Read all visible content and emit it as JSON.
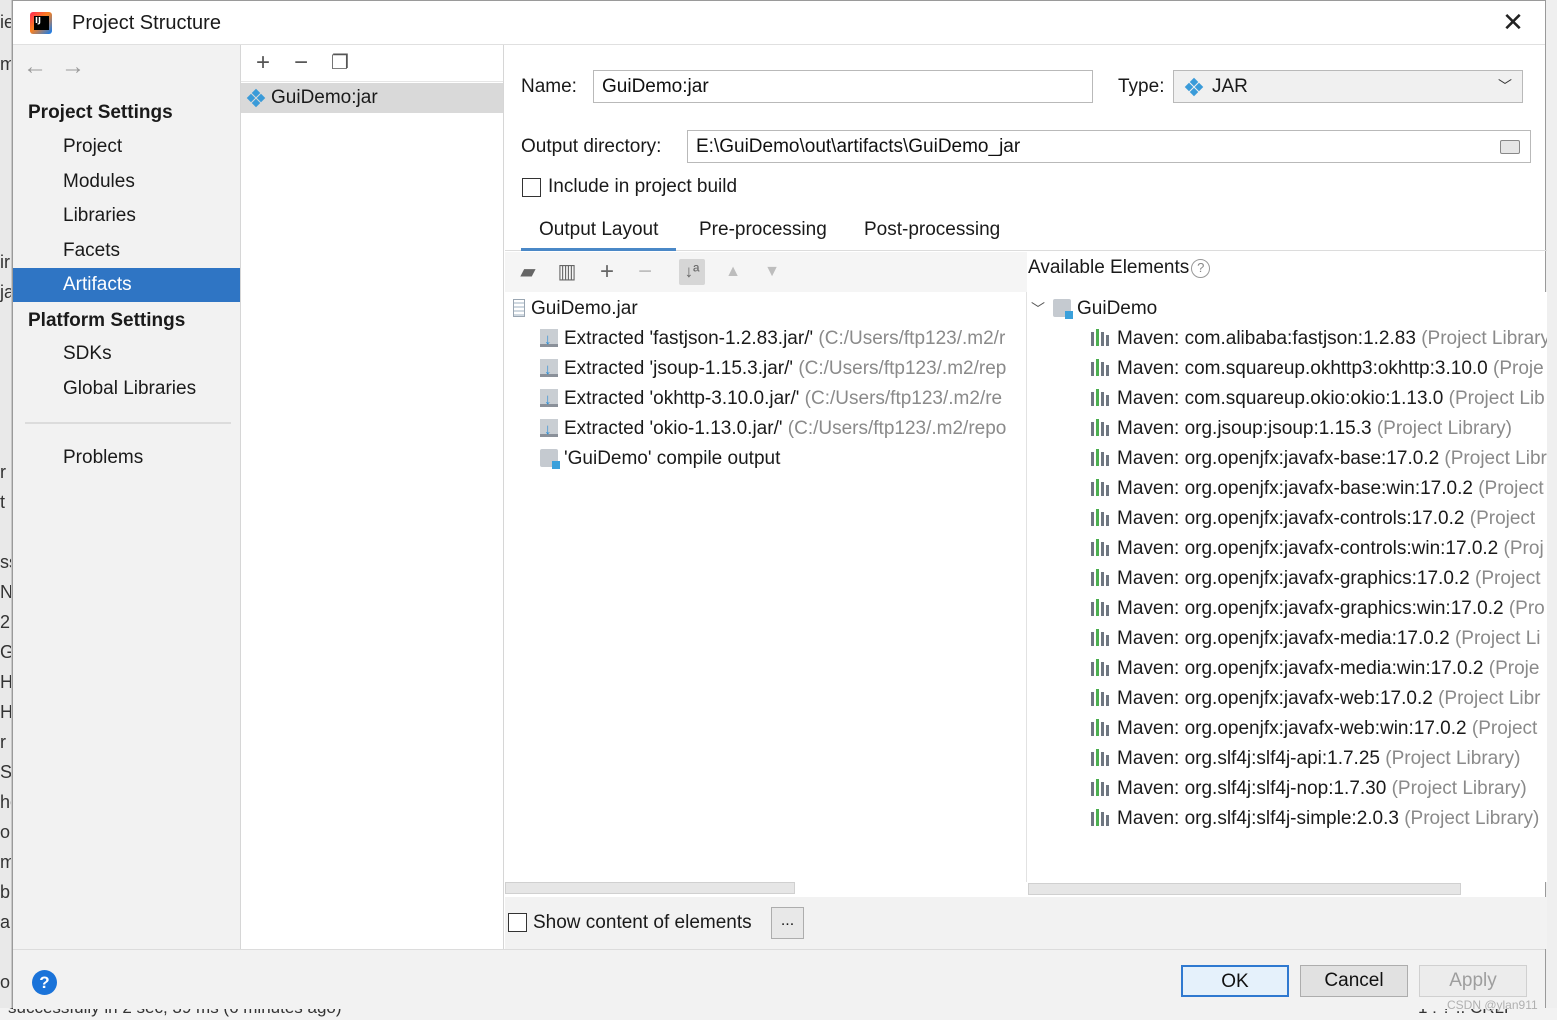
{
  "window": {
    "title": "Project Structure"
  },
  "nav": {
    "project_settings_label": "Project Settings",
    "platform_settings_label": "Platform Settings",
    "items": [
      {
        "label": "Project"
      },
      {
        "label": "Modules"
      },
      {
        "label": "Libraries"
      },
      {
        "label": "Facets"
      },
      {
        "label": "Artifacts",
        "selected": true
      }
    ],
    "platform_items": [
      {
        "label": "SDKs"
      },
      {
        "label": "Global Libraries"
      }
    ],
    "problems_label": "Problems"
  },
  "artifact_list": {
    "items": [
      {
        "label": "GuiDemo:jar",
        "selected": true
      }
    ]
  },
  "form": {
    "name_label": "Name:",
    "name_value": "GuiDemo:jar",
    "type_label": "Type:",
    "type_value": "JAR",
    "output_dir_label": "Output directory:",
    "output_dir_value": "E:\\GuiDemo\\out\\artifacts\\GuiDemo_jar",
    "include_build_label": "Include in project build",
    "include_build_checked": false
  },
  "tabs": [
    {
      "label": "Output Layout",
      "active": true
    },
    {
      "label": "Pre-processing"
    },
    {
      "label": "Post-processing"
    }
  ],
  "output_layout": {
    "root": "GuiDemo.jar",
    "entries": [
      {
        "label": "Extracted 'fastjson-1.2.83.jar/'",
        "path": "(C:/Users/ftp123/.m2/r"
      },
      {
        "label": "Extracted 'jsoup-1.15.3.jar/'",
        "path": "(C:/Users/ftp123/.m2/rep"
      },
      {
        "label": "Extracted 'okhttp-3.10.0.jar/'",
        "path": "(C:/Users/ftp123/.m2/re"
      },
      {
        "label": "Extracted 'okio-1.13.0.jar/'",
        "path": "(C:/Users/ftp123/.m2/repo"
      },
      {
        "label": "'GuiDemo' compile output",
        "path": ""
      }
    ]
  },
  "available": {
    "header": "Available Elements",
    "root": "GuiDemo",
    "libraries": [
      {
        "label": "Maven: com.alibaba:fastjson:1.2.83",
        "suffix": "(Project Library"
      },
      {
        "label": "Maven: com.squareup.okhttp3:okhttp:3.10.0",
        "suffix": "(Proje"
      },
      {
        "label": "Maven: com.squareup.okio:okio:1.13.0",
        "suffix": "(Project Lib"
      },
      {
        "label": "Maven: org.jsoup:jsoup:1.15.3",
        "suffix": "(Project Library)"
      },
      {
        "label": "Maven: org.openjfx:javafx-base:17.0.2",
        "suffix": "(Project Libr"
      },
      {
        "label": "Maven: org.openjfx:javafx-base:win:17.0.2",
        "suffix": "(Project"
      },
      {
        "label": "Maven: org.openjfx:javafx-controls:17.0.2",
        "suffix": "(Project"
      },
      {
        "label": "Maven: org.openjfx:javafx-controls:win:17.0.2",
        "suffix": "(Proj"
      },
      {
        "label": "Maven: org.openjfx:javafx-graphics:17.0.2",
        "suffix": "(Project"
      },
      {
        "label": "Maven: org.openjfx:javafx-graphics:win:17.0.2",
        "suffix": "(Pro"
      },
      {
        "label": "Maven: org.openjfx:javafx-media:17.0.2",
        "suffix": "(Project Li"
      },
      {
        "label": "Maven: org.openjfx:javafx-media:win:17.0.2",
        "suffix": "(Proje"
      },
      {
        "label": "Maven: org.openjfx:javafx-web:17.0.2",
        "suffix": "(Project Libr"
      },
      {
        "label": "Maven: org.openjfx:javafx-web:win:17.0.2",
        "suffix": "(Project"
      },
      {
        "label": "Maven: org.slf4j:slf4j-api:1.7.25",
        "suffix": "(Project Library)"
      },
      {
        "label": "Maven: org.slf4j:slf4j-nop:1.7.30",
        "suffix": "(Project Library)"
      },
      {
        "label": "Maven: org.slf4j:slf4j-simple:2.0.3",
        "suffix": "(Project Library)"
      }
    ]
  },
  "bottom": {
    "show_content_label": "Show content of elements",
    "ellipsis_label": "..."
  },
  "footer": {
    "help_label": "?",
    "ok_label": "OK",
    "cancel_label": "Cancel",
    "apply_label": "Apply"
  },
  "ide_background": {
    "status_text": "successfully in 2 sec, 39 ms (6 minutes ago)",
    "status_right": "1 : ? .. CRLF",
    "left_fragments": [
      "ie",
      "m",
      "ir",
      "ja",
      "r",
      "t",
      "ss",
      "N",
      "2",
      "G",
      "H",
      "H",
      "r",
      "S",
      "he",
      "o",
      "m",
      "b",
      "a",
      "o"
    ]
  },
  "watermark": "CSDN @ylan911",
  "colors": {
    "selection_blue": "#2f75c4",
    "primary_button_border": "#2f79d0",
    "tab_underline": "#4a88c7",
    "artifact_icon": "#3a9bd9"
  }
}
